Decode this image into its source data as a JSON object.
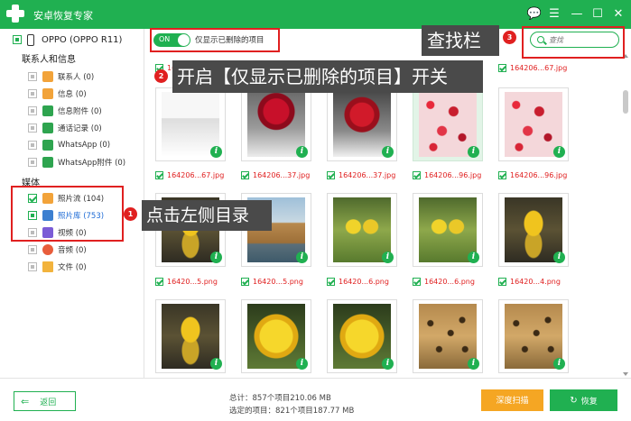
{
  "app": {
    "title": "安卓恢复专家"
  },
  "window_controls": {
    "chat": "💬",
    "menu": "☰",
    "minimize": "—",
    "maximize": "☐",
    "close": "✕"
  },
  "sidebar": {
    "device": "OPPO (OPPO R11)",
    "sections": [
      {
        "title": "联系人和信息",
        "items": [
          {
            "label": "联系人 (0)",
            "icon": "contacts-icon"
          },
          {
            "label": "信息 (0)",
            "icon": "message-icon"
          },
          {
            "label": "信息附件 (0)",
            "icon": "message-attachment-icon"
          },
          {
            "label": "通话记录 (0)",
            "icon": "call-log-icon"
          },
          {
            "label": "WhatsApp (0)",
            "icon": "whatsapp-icon"
          },
          {
            "label": "WhatsApp附件 (0)",
            "icon": "whatsapp-attachment-icon"
          }
        ]
      },
      {
        "title": "媒体",
        "items": [
          {
            "label": "照片流 (104)",
            "icon": "photo-stream-icon",
            "checked": true
          },
          {
            "label": "照片库 (753)",
            "icon": "photo-library-icon",
            "selected": true
          },
          {
            "label": "视频 (0)",
            "icon": "video-icon"
          },
          {
            "label": "音频 (0)",
            "icon": "audio-icon"
          },
          {
            "label": "文件 (0)",
            "icon": "folder-icon"
          }
        ]
      }
    ]
  },
  "toolbar": {
    "toggle_state": "ON",
    "toggle_label": "仅显示已删除的项目",
    "search_placeholder": "查找"
  },
  "annotations": {
    "step1_num": "1",
    "step1_text": "点击左侧目录",
    "step2_num": "2",
    "step2_text": "开启【仅显示已删除的项目】开关",
    "step3_num": "3",
    "step3_text": "查找栏",
    "highlight_color": "#e02020"
  },
  "grid": {
    "row0_labels": [
      "164206...67.jpg"
    ],
    "rows": [
      {
        "items": [
          {
            "pic": "app-screenshot",
            "name": "164206...67.jpg"
          },
          {
            "pic": "red-rose",
            "name": "164206...37.jpg"
          },
          {
            "pic": "red-rose",
            "name": "164206...37.jpg"
          },
          {
            "pic": "red-petals",
            "name": "164206...96.jpg"
          },
          {
            "pic": "red-petals",
            "name": "164206...96.jpg"
          }
        ]
      },
      {
        "items": [
          {
            "pic": "yellow-duck",
            "name": "16420...5.png"
          },
          {
            "pic": "old-town",
            "name": "16420...5.png"
          },
          {
            "pic": "yellow-tulips",
            "name": "16420...6.png"
          },
          {
            "pic": "yellow-tulips",
            "name": "16420...6.png"
          },
          {
            "pic": "yellow-duck",
            "name": "16420...4.png"
          }
        ]
      },
      {
        "items": [
          {
            "pic": "yellow-duck"
          },
          {
            "pic": "yellow-flower"
          },
          {
            "pic": "yellow-flower"
          },
          {
            "pic": "leopard"
          },
          {
            "pic": "leopard"
          }
        ]
      }
    ],
    "info_glyph": "i"
  },
  "footer": {
    "back_label": "返回",
    "total": "总计：857个项目210.06 MB",
    "selected": "选定的项目：821个项目187.77 MB",
    "deep_scan": "深度扫描",
    "recover": "恢复"
  },
  "colors": {
    "brand_green": "#20b051",
    "scan_orange": "#f5a623",
    "file_red": "#e02020"
  }
}
